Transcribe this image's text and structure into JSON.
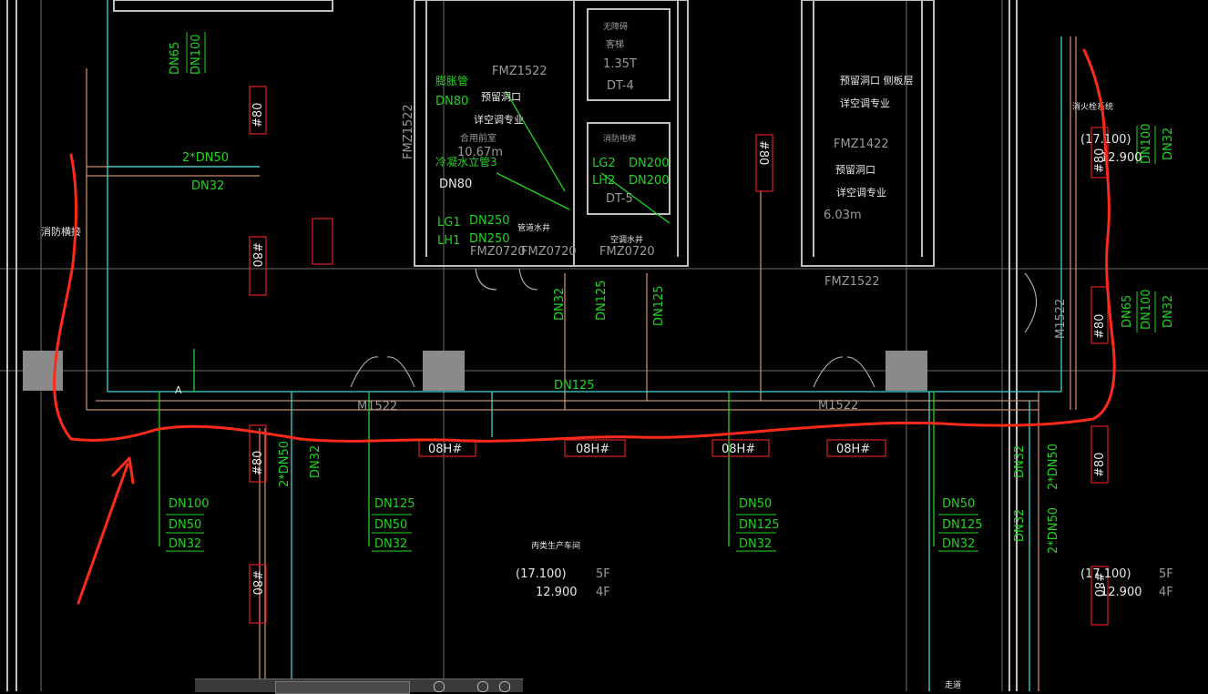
{
  "labels": {
    "dn65_a": "DN65",
    "dn100_a": "DN100",
    "tag80_a": "#80",
    "tag80_b": "#80",
    "tag80_c": "#80",
    "tag80_d": "#80",
    "tag80_e": "#80",
    "tag80_f": "#80",
    "tag80_g": "#80",
    "tag80_h": "#80",
    "tag80_i": "#80",
    "two_dn50_a": "2*DN50",
    "dn32_a": "DN32",
    "fire_hydrant": "消防横接",
    "expansion_pipe": "膨胀管",
    "dn80_a": "DN80",
    "reserved_hole_a": "预留洞口",
    "see_ac_a": "详空调专业",
    "fmz1522_a": "FMZ1522",
    "fmz1522_b": "FMZ1522",
    "fmz1522_c": "FMZ1522",
    "room_area_a": "10.67m",
    "room_name_a": "合用前室",
    "cold_water_riser": "冷凝水立管3",
    "dn80_b": "DN80",
    "lg1": "LG1",
    "lh1": "LH1",
    "dn250_a": "DN250",
    "dn250_b": "DN250",
    "fmz0720_a": "FMZ0720",
    "fmz0720_b": "FMZ0720",
    "fmz0720_c": "FMZ0720",
    "elev_dt4": "DT-4",
    "elev_135": "1.35T",
    "elev_room": "无障碍",
    "elev_guest": "客梯",
    "fire_elev": "消防电梯",
    "lg2": "LG2",
    "lh2": "LH2",
    "dn200_a": "DN200",
    "dn200_b": "DN200",
    "dt5": "DT-5",
    "well_a": "管道水井",
    "well_b": "空调水井",
    "reserved_hole_b": "预留洞口 侧板层",
    "see_ac_b": "详空调专业",
    "fmz1422": "FMZ1422",
    "reserved_hole_c": "预留洞口",
    "see_ac_c": "详空调专业",
    "room_area_b": "6.03m",
    "dn32_b": "DN32",
    "dn125_a": "DN125",
    "dn125_b": "DN125",
    "m1522_a": "M1522",
    "m1522_b": "M1522",
    "m1522_c": "M1522",
    "dn125_c": "DN125",
    "mark_a": "A",
    "h08_a": "08H#",
    "h08_b": "08H#",
    "h08_c": "08H#",
    "h08_d": "08H#",
    "col_a1": "DN100",
    "col_a2": "DN50",
    "col_a3": "DN32",
    "col_b1": "DN125",
    "col_b2": "DN50",
    "col_b3": "DN32",
    "col_c1": "DN50",
    "col_c2": "DN125",
    "col_c3": "DN32",
    "col_d1": "DN50",
    "col_d2": "DN125",
    "col_d3": "DN32",
    "two_dn50_b": "2*DN50",
    "dn32_c": "DN32",
    "workshop": "丙类生产车间",
    "elev_top_a": "(17.100)",
    "elev_bot_a": "12.900",
    "floor5_a": "5F",
    "floor4_a": "4F",
    "elev_top_b": "(17.100)",
    "elev_bot_b": "12.900",
    "floor5_b": "5F",
    "floor4_b": "4F",
    "elev_top_c": "(17.100)",
    "elev_bot_c": "12.900",
    "right_dn65": "DN65",
    "right_dn100": "DN100",
    "right_dn32": "DN32",
    "right_top_dn100": "DN100",
    "right_top_dn32": "DN32",
    "right_dn32_a": "DN32",
    "right_2dn50": "2*DN50",
    "right_dn32_b": "DN32",
    "right_2dn50_b": "2*DN50",
    "right_note": "消火栓系统",
    "walkway": "走道"
  },
  "annotation": {
    "highlight_color": "#ff2a1a"
  },
  "colors": {
    "pipe_green": "#1fd51f",
    "pipe_cyan": "#3fd6d6",
    "wall": "#bfbfbf",
    "tag_red": "#e02020",
    "pipe_brown": "#c88a6a"
  }
}
